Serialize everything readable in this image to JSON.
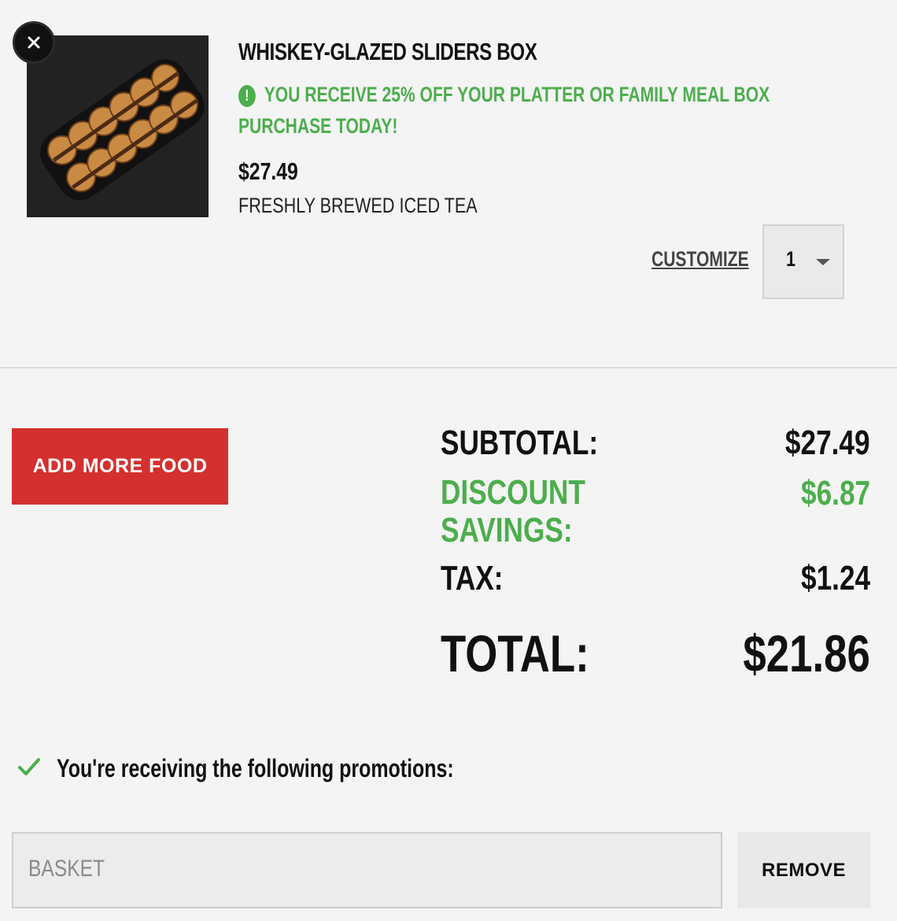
{
  "item": {
    "image_name": "sliders-platter-photo",
    "title": "WHISKEY-GLAZED SLIDERS BOX",
    "promo_message": "YOU RECEIVE 25% OFF YOUR PLATTER OR FAMILY MEAL BOX PURCHASE TODAY!",
    "price": "$27.49",
    "side": "FRESHLY BREWED ICED TEA",
    "customize_label": "CUSTOMIZE",
    "quantity": "1",
    "remove_icon": "close-icon"
  },
  "actions": {
    "add_more_label": "ADD MORE FOOD"
  },
  "summary": {
    "subtotal_label": "SUBTOTAL:",
    "subtotal_value": "$27.49",
    "discount_label": "DISCOUNT SAVINGS:",
    "discount_value": "$6.87",
    "tax_label": "TAX:",
    "tax_value": "$1.24",
    "total_label": "TOTAL:",
    "total_value": "$21.86"
  },
  "promotions": {
    "heading": "You're receiving the following promotions:",
    "applied_code": "BASKET",
    "remove_label": "REMOVE"
  },
  "colors": {
    "accent_green": "#4cae4c",
    "button_red": "#d3302f",
    "background": "#f4f4f4"
  }
}
